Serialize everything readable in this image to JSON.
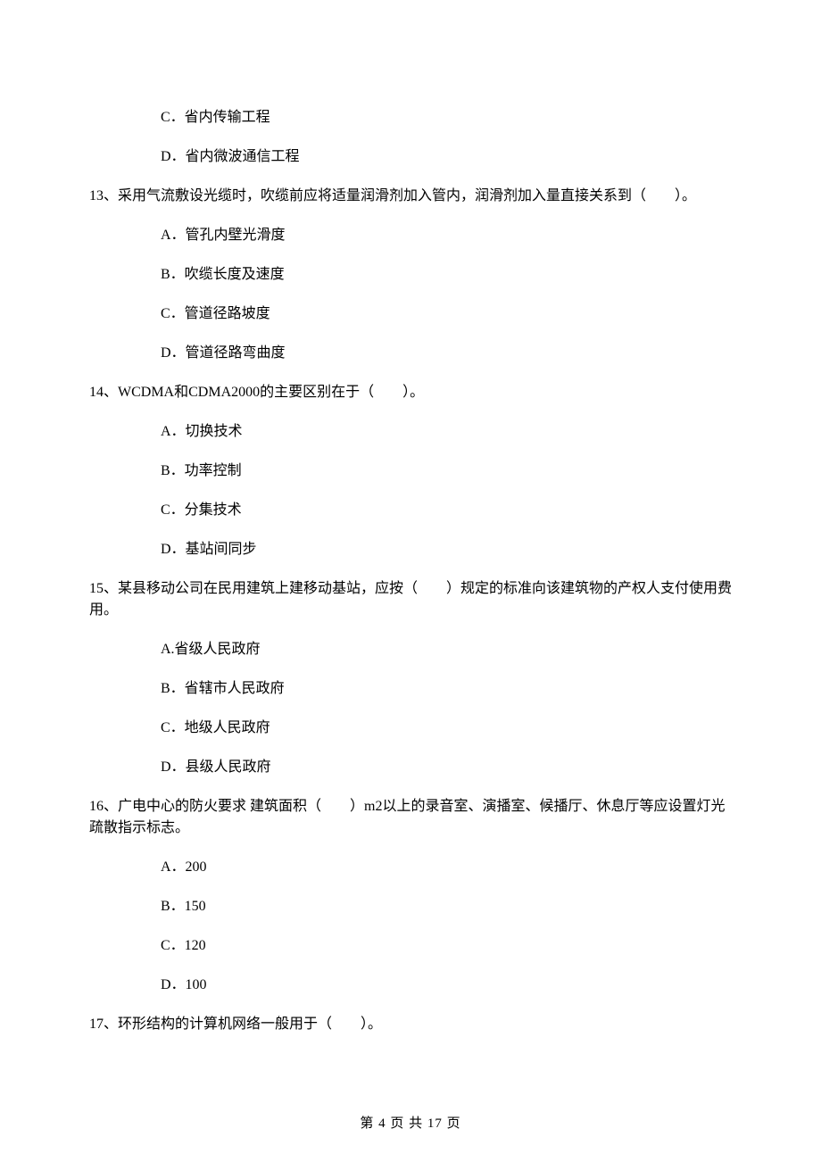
{
  "q12_options": {
    "c": "C．省内传输工程",
    "d": "D．省内微波通信工程"
  },
  "q13": {
    "stem": "13、采用气流敷设光缆时，吹缆前应将适量润滑剂加入管内，润滑剂加入量直接关系到（　　）。",
    "a": "A．管孔内壁光滑度",
    "b": "B．吹缆长度及速度",
    "c": "C．管道径路坡度",
    "d": "D．管道径路弯曲度"
  },
  "q14": {
    "stem": "14、WCDMA和CDMA2000的主要区别在于（　　）。",
    "a": "A．切换技术",
    "b": "B．功率控制",
    "c": "C．分集技术",
    "d": "D．基站间同步"
  },
  "q15": {
    "stem": "15、某县移动公司在民用建筑上建移动基站，应按（　　）规定的标准向该建筑物的产权人支付使用费用。",
    "a": "A.省级人民政府",
    "b": "B．省辖市人民政府",
    "c": "C．地级人民政府",
    "d": "D．县级人民政府"
  },
  "q16": {
    "stem": "16、广电中心的防火要求 建筑面积（　　）m2以上的录音室、演播室、候播厅、休息厅等应设置灯光疏散指示标志。",
    "a": "A．200",
    "b": "B．150",
    "c": "C．120",
    "d": "D．100"
  },
  "q17": {
    "stem": "17、环形结构的计算机网络一般用于（　　）。"
  },
  "footer": "第 4 页 共 17 页"
}
